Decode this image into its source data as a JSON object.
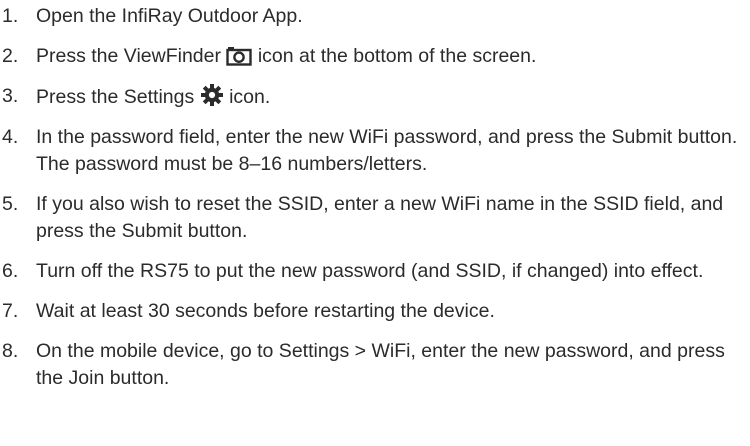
{
  "steps": [
    {
      "number": "1.",
      "text": "Open the InfiRay Outdoor App."
    },
    {
      "number": "2.",
      "before": "Press the ViewFinder",
      "icon": "camera-icon",
      "after": "icon at the bottom of the screen."
    },
    {
      "number": "3.",
      "before": "Press the Settings",
      "icon": "gear-icon",
      "after": "icon."
    },
    {
      "number": "4.",
      "text": "In the password field, enter the new WiFi password, and press the Submit button. The password must be 8–16 numbers/letters."
    },
    {
      "number": "5.",
      "text": "If you also wish to reset the SSID, enter a new WiFi name in the SSID field, and press the Submit button."
    },
    {
      "number": "6.",
      "text": "Turn off the RS75 to put the new password (and SSID, if changed) into effect."
    },
    {
      "number": "7.",
      "text": "Wait at least 30 seconds before restarting the device."
    },
    {
      "number": "8.",
      "text": "On the mobile device, go to Settings > WiFi, enter the new password, and press the Join button."
    }
  ],
  "colors": {
    "text": "#2b2b2b"
  }
}
